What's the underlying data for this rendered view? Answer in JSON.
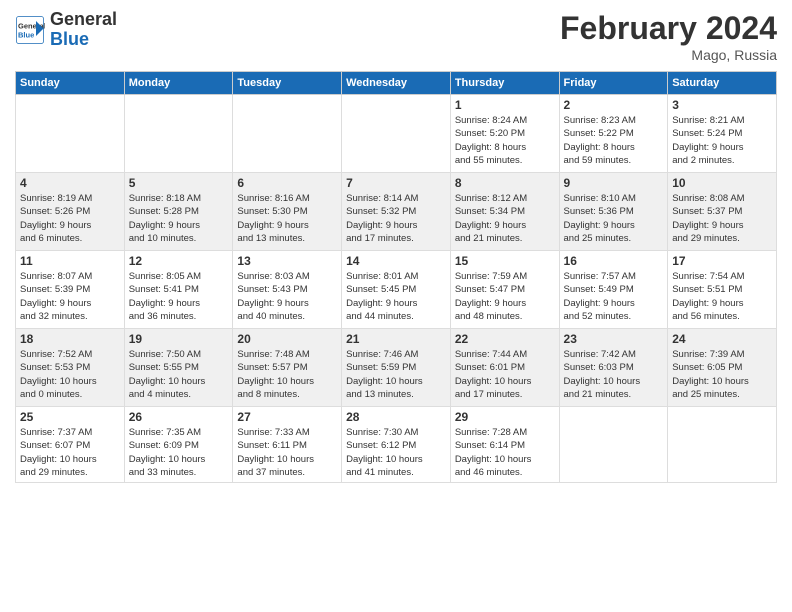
{
  "header": {
    "logo_line1": "General",
    "logo_line2": "Blue",
    "title": "February 2024",
    "subtitle": "Mago, Russia"
  },
  "weekdays": [
    "Sunday",
    "Monday",
    "Tuesday",
    "Wednesday",
    "Thursday",
    "Friday",
    "Saturday"
  ],
  "weeks": [
    [
      {
        "day": "",
        "info": ""
      },
      {
        "day": "",
        "info": ""
      },
      {
        "day": "",
        "info": ""
      },
      {
        "day": "",
        "info": ""
      },
      {
        "day": "1",
        "info": "Sunrise: 8:24 AM\nSunset: 5:20 PM\nDaylight: 8 hours\nand 55 minutes."
      },
      {
        "day": "2",
        "info": "Sunrise: 8:23 AM\nSunset: 5:22 PM\nDaylight: 8 hours\nand 59 minutes."
      },
      {
        "day": "3",
        "info": "Sunrise: 8:21 AM\nSunset: 5:24 PM\nDaylight: 9 hours\nand 2 minutes."
      }
    ],
    [
      {
        "day": "4",
        "info": "Sunrise: 8:19 AM\nSunset: 5:26 PM\nDaylight: 9 hours\nand 6 minutes."
      },
      {
        "day": "5",
        "info": "Sunrise: 8:18 AM\nSunset: 5:28 PM\nDaylight: 9 hours\nand 10 minutes."
      },
      {
        "day": "6",
        "info": "Sunrise: 8:16 AM\nSunset: 5:30 PM\nDaylight: 9 hours\nand 13 minutes."
      },
      {
        "day": "7",
        "info": "Sunrise: 8:14 AM\nSunset: 5:32 PM\nDaylight: 9 hours\nand 17 minutes."
      },
      {
        "day": "8",
        "info": "Sunrise: 8:12 AM\nSunset: 5:34 PM\nDaylight: 9 hours\nand 21 minutes."
      },
      {
        "day": "9",
        "info": "Sunrise: 8:10 AM\nSunset: 5:36 PM\nDaylight: 9 hours\nand 25 minutes."
      },
      {
        "day": "10",
        "info": "Sunrise: 8:08 AM\nSunset: 5:37 PM\nDaylight: 9 hours\nand 29 minutes."
      }
    ],
    [
      {
        "day": "11",
        "info": "Sunrise: 8:07 AM\nSunset: 5:39 PM\nDaylight: 9 hours\nand 32 minutes."
      },
      {
        "day": "12",
        "info": "Sunrise: 8:05 AM\nSunset: 5:41 PM\nDaylight: 9 hours\nand 36 minutes."
      },
      {
        "day": "13",
        "info": "Sunrise: 8:03 AM\nSunset: 5:43 PM\nDaylight: 9 hours\nand 40 minutes."
      },
      {
        "day": "14",
        "info": "Sunrise: 8:01 AM\nSunset: 5:45 PM\nDaylight: 9 hours\nand 44 minutes."
      },
      {
        "day": "15",
        "info": "Sunrise: 7:59 AM\nSunset: 5:47 PM\nDaylight: 9 hours\nand 48 minutes."
      },
      {
        "day": "16",
        "info": "Sunrise: 7:57 AM\nSunset: 5:49 PM\nDaylight: 9 hours\nand 52 minutes."
      },
      {
        "day": "17",
        "info": "Sunrise: 7:54 AM\nSunset: 5:51 PM\nDaylight: 9 hours\nand 56 minutes."
      }
    ],
    [
      {
        "day": "18",
        "info": "Sunrise: 7:52 AM\nSunset: 5:53 PM\nDaylight: 10 hours\nand 0 minutes."
      },
      {
        "day": "19",
        "info": "Sunrise: 7:50 AM\nSunset: 5:55 PM\nDaylight: 10 hours\nand 4 minutes."
      },
      {
        "day": "20",
        "info": "Sunrise: 7:48 AM\nSunset: 5:57 PM\nDaylight: 10 hours\nand 8 minutes."
      },
      {
        "day": "21",
        "info": "Sunrise: 7:46 AM\nSunset: 5:59 PM\nDaylight: 10 hours\nand 13 minutes."
      },
      {
        "day": "22",
        "info": "Sunrise: 7:44 AM\nSunset: 6:01 PM\nDaylight: 10 hours\nand 17 minutes."
      },
      {
        "day": "23",
        "info": "Sunrise: 7:42 AM\nSunset: 6:03 PM\nDaylight: 10 hours\nand 21 minutes."
      },
      {
        "day": "24",
        "info": "Sunrise: 7:39 AM\nSunset: 6:05 PM\nDaylight: 10 hours\nand 25 minutes."
      }
    ],
    [
      {
        "day": "25",
        "info": "Sunrise: 7:37 AM\nSunset: 6:07 PM\nDaylight: 10 hours\nand 29 minutes."
      },
      {
        "day": "26",
        "info": "Sunrise: 7:35 AM\nSunset: 6:09 PM\nDaylight: 10 hours\nand 33 minutes."
      },
      {
        "day": "27",
        "info": "Sunrise: 7:33 AM\nSunset: 6:11 PM\nDaylight: 10 hours\nand 37 minutes."
      },
      {
        "day": "28",
        "info": "Sunrise: 7:30 AM\nSunset: 6:12 PM\nDaylight: 10 hours\nand 41 minutes."
      },
      {
        "day": "29",
        "info": "Sunrise: 7:28 AM\nSunset: 6:14 PM\nDaylight: 10 hours\nand 46 minutes."
      },
      {
        "day": "",
        "info": ""
      },
      {
        "day": "",
        "info": ""
      }
    ]
  ]
}
